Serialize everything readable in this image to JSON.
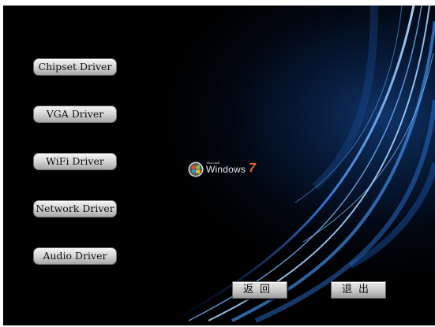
{
  "drivers": {
    "chipset": "Chipset Driver",
    "vga": "VGA Driver",
    "wifi": "WiFi Driver",
    "network": "Network Driver",
    "audio": "Audio Driver"
  },
  "actions": {
    "back": "返回",
    "exit": "退出"
  },
  "logo": {
    "microsoft": "Microsoft",
    "windows": "Windows",
    "version": "7"
  },
  "colors": {
    "background": "#000000",
    "streak": "#4aa3ff",
    "seven": "#e86a1a"
  }
}
